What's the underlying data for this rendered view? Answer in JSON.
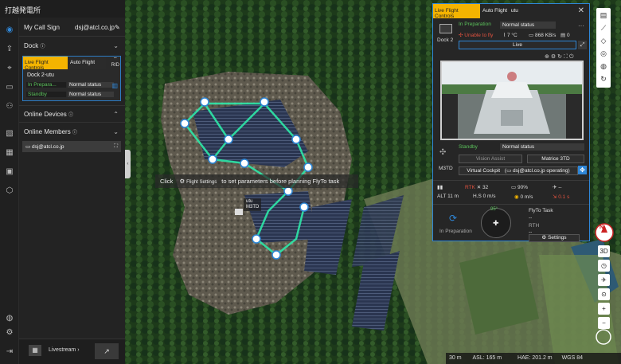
{
  "app": {
    "title": "打越発電所"
  },
  "left_panel": {
    "call_sign_label": "My Call Sign",
    "call_sign_value": "dsj@atcl.co.jp",
    "dock_label": "Dock",
    "dock_tabs": [
      "Live Flight Controls",
      "Auto Flight"
    ],
    "rid_label": "RID",
    "dock_name": "Dock 2-utu",
    "dock_rows": [
      {
        "key": "In Prepara...",
        "value": "Normal status"
      },
      {
        "key": "Standby",
        "value": "Normal status"
      }
    ],
    "online_devices_label": "Online Devices",
    "online_members_label": "Online Members",
    "member": "dsj@atcl.co.jp",
    "livestream_label": "Livestream"
  },
  "map": {
    "hint_pre": "Click",
    "hint_button": "Flight Settings",
    "hint_post": "to set parameters before planning FlyTo task",
    "drone_label_a": "utu",
    "drone_label_b": "M3TD",
    "status": {
      "scale": "30 m",
      "asl": "ASL: 165 m",
      "hae": "HAE: 201.2 m",
      "datum": "WGS 84"
    }
  },
  "right_panel": {
    "tabs": [
      "Live Flight Controls",
      "Auto Flight",
      "utu"
    ],
    "dock_label": "Dock 2",
    "dock_status_key": "In Preparation",
    "dock_status_value": "Normal status",
    "unable_label": "Unable to fly",
    "temperature": "7 °C",
    "network": "868 KB/s",
    "storage": "0",
    "live_label": "Live",
    "drone_status_key": "Standby",
    "drone_status_value": "Normal status",
    "drone_model_label": "M3TD",
    "vision_assist_label": "Vision Assist",
    "camera_label": "Matrice 3TD",
    "virtual_cockpit_label": "Virtual Cockpit",
    "operator_label": "dsj@atcl.co.jp operating",
    "rtk_label": "RTK",
    "rtk_value": "32",
    "battery": "90%",
    "battery_time": "--",
    "alt": "ALT 11 m",
    "hspeed": "H.S 0 m/s",
    "vspeed": "0 m/s",
    "wind": "0.1 s",
    "in_prep_label": "In Preparation",
    "heading": "95°",
    "flyto_label": "FlyTo Task",
    "flyto_value": "--",
    "rth_label": "RTH",
    "rth_value": "--",
    "settings_label": "Settings"
  },
  "toolbar": {
    "view3d": "3D",
    "compass": "N"
  }
}
